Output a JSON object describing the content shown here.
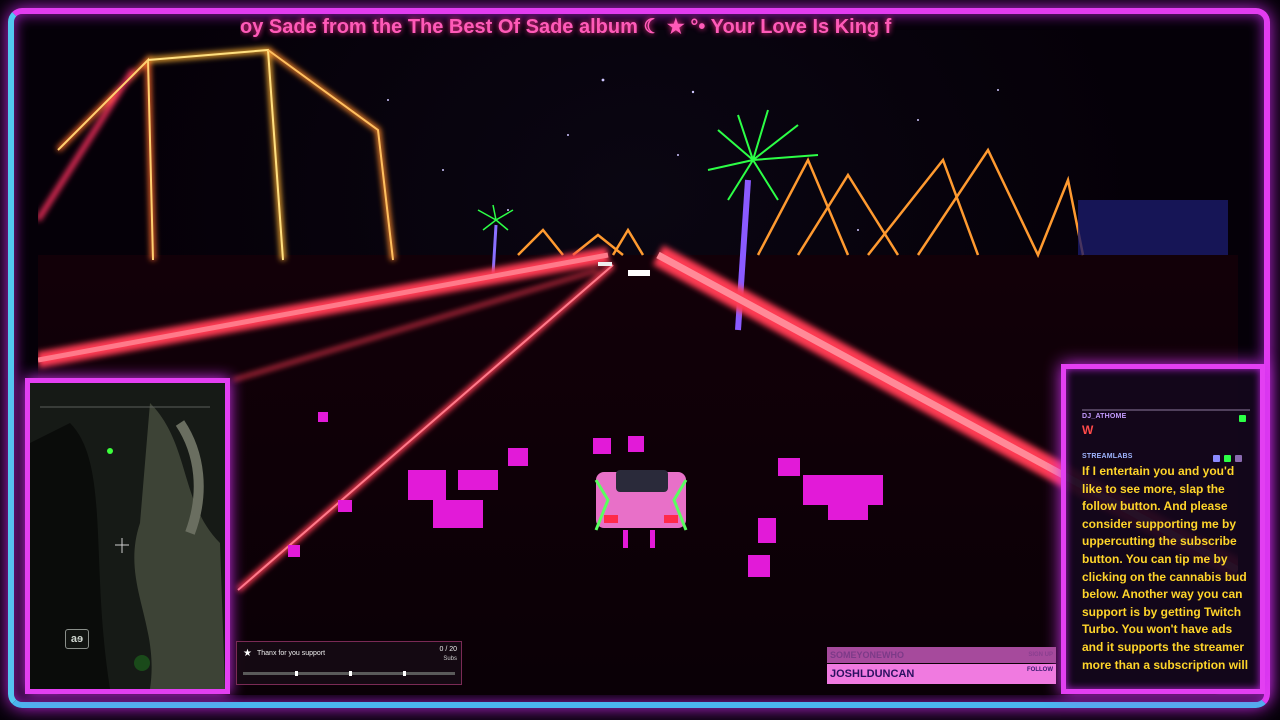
{
  "ticker": {
    "text": "oy Sade from the The Best Of Sade album  ☾ ★ °• Your Love Is King f"
  },
  "webcam": {
    "badge": "aɘ"
  },
  "chat": {
    "messages": [
      {
        "user": "DJ_ATHOME",
        "text": "W"
      },
      {
        "user": "STREAMLABS",
        "text": "If I entertain you and you'd like to see more, slap the follow button. And please consider supporting me by uppercutting the subscribe button. You can tip me by clicking on the cannabis bud below. Another way you can support is by getting Twitch Turbo. You won't have ads and it supports the streamer more than a subscription will"
      }
    ]
  },
  "sub_goal": {
    "label": "Thanx for you support",
    "count": "0 / 20",
    "unit": "Subs",
    "progress": 0
  },
  "follow_alert": {
    "previous_name": "SOMEYONEWHO",
    "previous_tag": "SIGN UP",
    "name": "JOSHLDUNCAN",
    "tag": "FOLLOW"
  },
  "colors": {
    "frame": "#e23cf0",
    "frame_left": "#52c8f0",
    "road_glow": "#ff3a52",
    "ticker": "#ff5ab8",
    "chat_text": "#ffd52a"
  }
}
